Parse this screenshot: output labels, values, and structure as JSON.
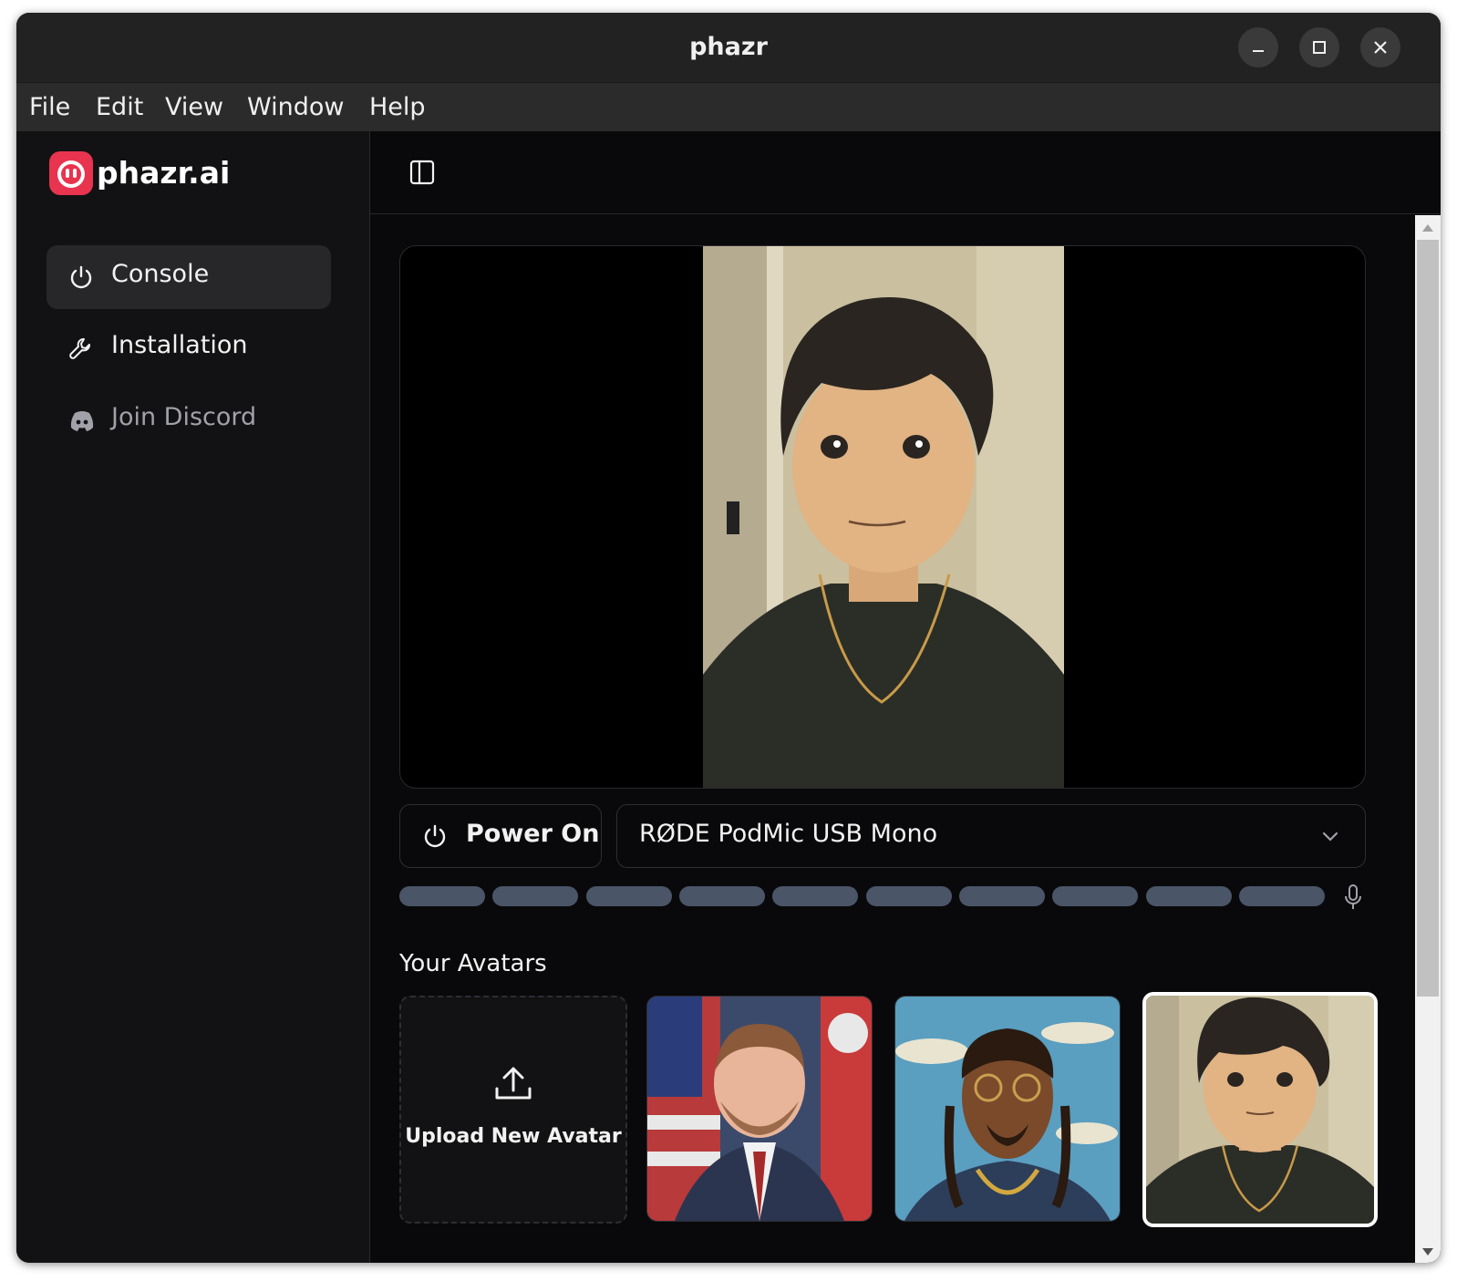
{
  "window": {
    "title": "phazr"
  },
  "menu": [
    "File",
    "Edit",
    "View",
    "Window",
    "Help"
  ],
  "sidebar": {
    "logo_text": "phazr.ai",
    "items": [
      {
        "label": "Console",
        "icon": "power-icon",
        "active": true
      },
      {
        "label": "Installation",
        "icon": "wrench-icon",
        "active": false
      },
      {
        "label": "Join Discord",
        "icon": "discord-icon",
        "active": false
      }
    ]
  },
  "controls": {
    "power_label": "Power On",
    "microphone_selected": "RØDE PodMic USB Mono"
  },
  "level_meter": {
    "segments": 10,
    "level": 0
  },
  "avatars": {
    "title": "Your Avatars",
    "upload_label": "Upload New Avatar",
    "selected_index": 2,
    "items": [
      "avatar-man-suit-flags",
      "avatar-cartoon-rapper",
      "avatar-anime-boy"
    ]
  },
  "colors": {
    "brand": "#e8344e",
    "level_off": "#4a5568",
    "background": "#09090b"
  }
}
